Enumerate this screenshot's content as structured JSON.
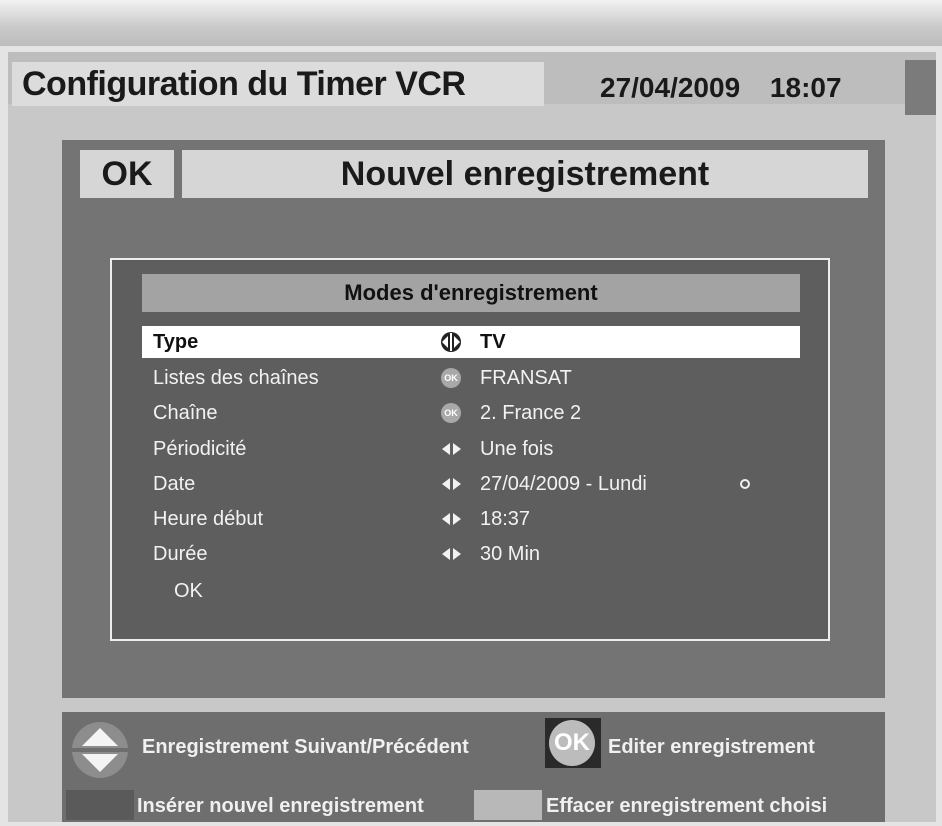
{
  "header": {
    "title": "Configuration du Timer VCR",
    "date": "27/04/2009",
    "time": "18:07"
  },
  "dialog": {
    "ok_label": "OK",
    "title": "Nouvel enregistrement"
  },
  "modes": {
    "title": "Modes d'enregistrement",
    "rows": [
      {
        "label": "Type",
        "value": "TV",
        "icon": "left-right-circle-icon"
      },
      {
        "label": "Listes des chaînes",
        "value": "FRANSAT",
        "icon": "ok-button-icon"
      },
      {
        "label": "Chaîne",
        "value": "2. France 2",
        "icon": "ok-button-icon"
      },
      {
        "label": "Périodicité",
        "value": "Une fois",
        "icon": "left-right-arrows-icon"
      },
      {
        "label": "Date",
        "value": "27/04/2009 - Lundi",
        "icon": "left-right-arrows-icon"
      },
      {
        "label": "Heure début",
        "value": "18:37",
        "icon": "left-right-arrows-icon"
      },
      {
        "label": "Durée",
        "value": "30 Min",
        "icon": "left-right-arrows-icon"
      }
    ],
    "ok_text": "OK",
    "ok_badge": "OK"
  },
  "footer": {
    "nav_text": "Enregistrement Suivant/Précédent",
    "ok_key": "OK",
    "edit_text": "Editer enregistrement",
    "insert_text": "Insérer nouvel enregistrement",
    "delete_text": "Effacer enregistrement choisi"
  }
}
